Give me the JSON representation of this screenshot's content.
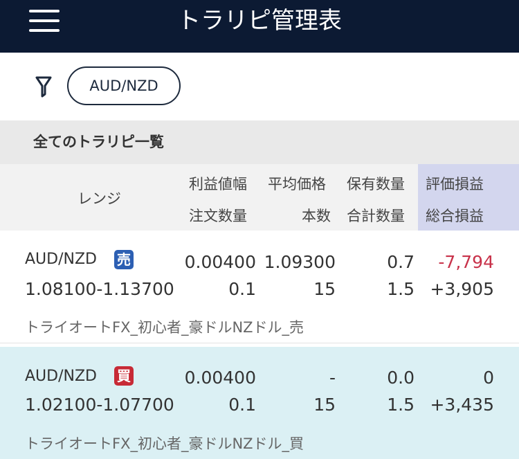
{
  "header": {
    "title": "トラリピ管理表",
    "menu_icon": "hamburger-menu-icon"
  },
  "filter": {
    "icon": "filter-funnel-icon",
    "selected_pair": "AUD/NZD"
  },
  "section": {
    "title": "全てのトラリピ一覧"
  },
  "table_header": {
    "range": "レンジ",
    "profit_width": "利益値幅",
    "order_qty": "注文数量",
    "avg_price": "平均価格",
    "count": "本数",
    "holding_qty": "保有数量",
    "total_qty": "合計数量",
    "eval_pl": "評価損益",
    "total_pl": "総合損益"
  },
  "rows": [
    {
      "pair": "AUD/NZD",
      "side": "売",
      "range": "1.08100-1.13700",
      "profit_width": "0.00400",
      "order_qty": "0.1",
      "avg_price": "1.09300",
      "count": "15",
      "holding_qty": "0.7",
      "total_qty": "1.5",
      "eval_pl": "-7,794",
      "total_pl": "+3,905",
      "strategy": "トライオートFX_初心者_豪ドルNZドル_売"
    },
    {
      "pair": "AUD/NZD",
      "side": "買",
      "range": "1.02100-1.07700",
      "profit_width": "0.00400",
      "order_qty": "0.1",
      "avg_price": "-",
      "count": "15",
      "holding_qty": "0.0",
      "total_qty": "1.5",
      "eval_pl": "0",
      "total_pl": "+3,435",
      "strategy": "トライオートFX_初心者_豪ドルNZドル_買"
    }
  ],
  "colors": {
    "header_bg": "#0c1a33",
    "sell": "#2c5fb3",
    "buy": "#c72a36",
    "negative": "#c8324a",
    "buy_row_bg": "#dbf0f4",
    "eval_col_bg": "#d3d6ee"
  }
}
